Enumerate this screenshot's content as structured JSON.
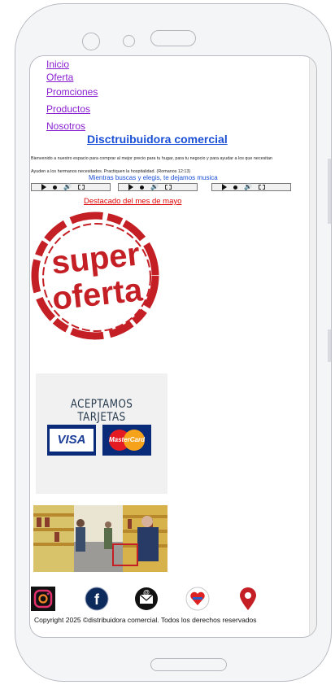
{
  "nav": [
    {
      "label": "Inicio"
    },
    {
      "label": "Oferta"
    },
    {
      "label": "Promciones"
    },
    {
      "label": "Productos"
    },
    {
      "label": "Nosotros"
    }
  ],
  "title": "Disctruibuidora comercial",
  "intro": {
    "p1": "Bienvenido a nuestro espacio para comprar al mejor precio para tu hugar, para tu negocio y para ayudar a los que necesitan",
    "p2": "Ayuden a los hermanos necesitados. Practiquen la hospitalidad. (Romanos 12:13)"
  },
  "music_caption": "Mientras buscas y elegis, te dejamos musica",
  "featured": "Destacado del mes de mayo",
  "stamp": {
    "line1": "super",
    "line2": "oferta"
  },
  "cards": {
    "title": "ACEPTAMOS TARJETAS",
    "visa": "VISA",
    "mastercard": "MasterCard"
  },
  "social": [
    "instagram-icon",
    "facebook-icon",
    "email-icon",
    "heart-icon",
    "location-pin-icon"
  ],
  "footer": {
    "copyright": "Copyright 2025 ©distribuidora comercial. Todos los derechos reservados"
  },
  "colors": {
    "nav_link": "#8a1fd2",
    "title": "#1a4fd6",
    "featured": "#dd0000",
    "stamp_red": "#c41f24"
  }
}
